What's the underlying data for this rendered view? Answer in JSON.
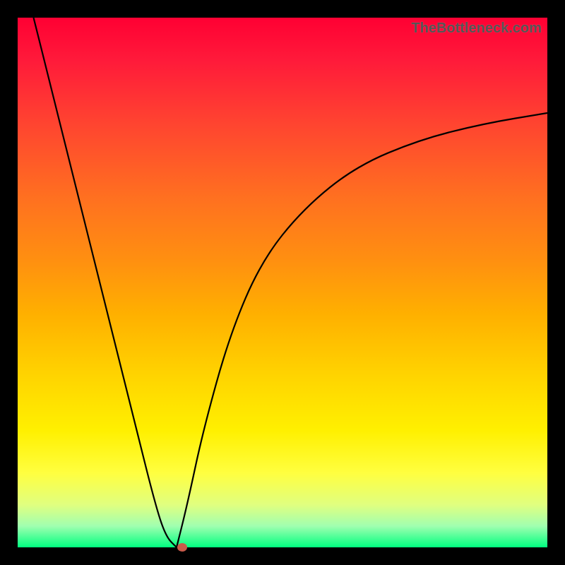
{
  "attribution": "TheBottleneck.com",
  "colors": {
    "background": "#000000",
    "curve": "#000000",
    "marker": "#c95a4a"
  },
  "chart_data": {
    "type": "line",
    "title": "",
    "xlabel": "",
    "ylabel": "",
    "xlim": [
      0,
      100
    ],
    "ylim": [
      0,
      100
    ],
    "grid": false,
    "legend": false,
    "annotations": [],
    "series": [
      {
        "name": "left-branch",
        "x": [
          3,
          6,
          10,
          14,
          18,
          22,
          26,
          28,
          30
        ],
        "y": [
          100,
          88,
          72,
          56,
          40,
          24,
          8,
          2,
          0
        ]
      },
      {
        "name": "right-branch",
        "x": [
          30,
          32,
          35,
          40,
          46,
          54,
          64,
          76,
          88,
          100
        ],
        "y": [
          0,
          8,
          22,
          40,
          54,
          64,
          72,
          77,
          80,
          82
        ]
      }
    ],
    "marker": {
      "x": 31,
      "y": 0
    },
    "background_gradient": [
      {
        "stop": 0,
        "color": "#ff0033"
      },
      {
        "stop": 50,
        "color": "#ff9900"
      },
      {
        "stop": 80,
        "color": "#ffff00"
      },
      {
        "stop": 100,
        "color": "#00ff80"
      }
    ]
  }
}
